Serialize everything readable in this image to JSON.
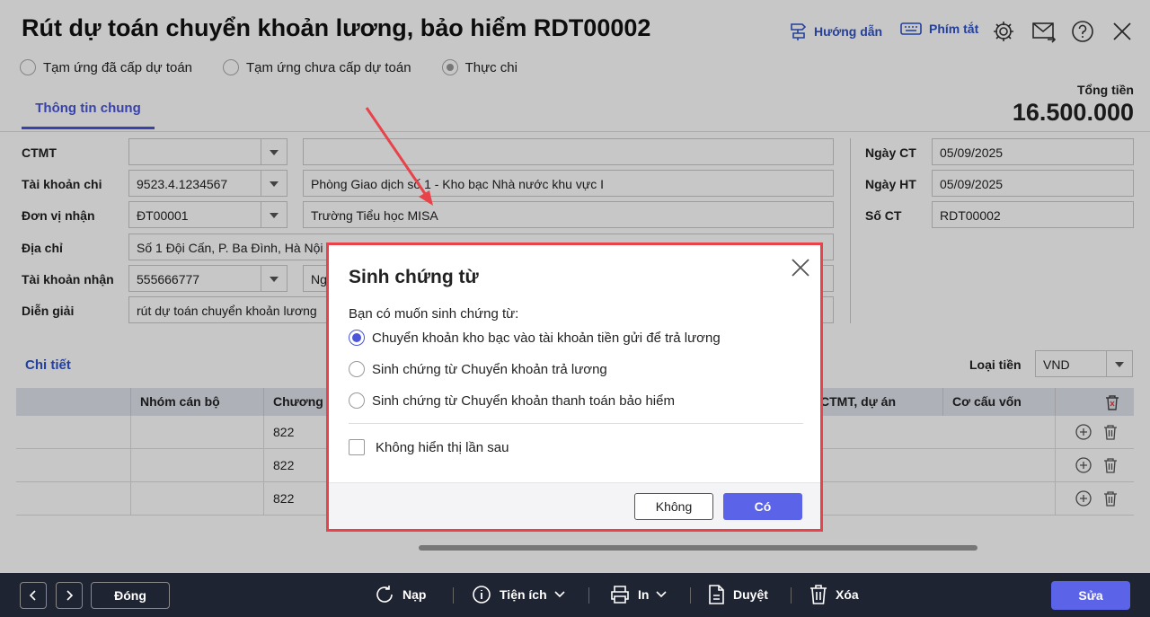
{
  "header": {
    "title": "Rút dự toán chuyển khoản lương, bảo hiểm RDT00002",
    "guide_label": "Hướng dẫn",
    "shortcut_label": "Phím tắt"
  },
  "radios": {
    "r1": "Tạm ứng đã cấp dự toán",
    "r2": "Tạm ứng chưa cấp dự toán",
    "r3": "Thực chi"
  },
  "tab": "Thông tin chung",
  "total": {
    "label": "Tổng tiền",
    "value": "16.500.000"
  },
  "form": {
    "ctmt_label": "CTMT",
    "taikhoanchi_label": "Tài khoản chi",
    "taikhoanchi_value": "9523.4.1234567",
    "taikhoanchi_name": "Phòng Giao dịch số 1 - Kho bạc Nhà nước khu vực I",
    "donvinhan_label": "Đơn vị nhận",
    "donvinhan_value": "ĐT00001",
    "donvinhan_name": "Trường Tiểu học MISA",
    "diachi_label": "Địa chỉ",
    "diachi_value": "Số 1 Đội Cấn, P. Ba Đình, Hà Nội",
    "taikhoannhan_label": "Tài khoản nhận",
    "taikhoannhan_value": "555666777",
    "taikhoannhan_name": "Ng",
    "diengiai_label": "Diễn giải",
    "diengiai_value": "rút dự toán chuyển khoản lương",
    "ngayct_label": "Ngày CT",
    "ngayct_value": "05/09/2025",
    "ngayht_label": "Ngày HT",
    "ngayht_value": "05/09/2025",
    "soct_label": "Số CT",
    "soct_value": "RDT00002"
  },
  "detail": {
    "title": "Chi tiết",
    "currency_label": "Loại tiền",
    "currency_value": "VND",
    "columns": {
      "c2": "Nhóm cán bộ",
      "c3": "Chương",
      "c4": "CTMT, dự án",
      "c5": "Cơ cấu vốn"
    },
    "rows": [
      "822",
      "822",
      "822"
    ]
  },
  "footer": {
    "close": "Đóng",
    "reload": "Nạp",
    "utility": "Tiện ích",
    "print": "In",
    "approve": "Duyệt",
    "delete": "Xóa",
    "edit": "Sửa"
  },
  "dialog": {
    "title": "Sinh chứng từ",
    "question": "Bạn có muốn sinh chứng từ:",
    "options": [
      "Chuyển khoản kho bạc vào tài khoản tiền gửi để trả lương",
      "Sinh chứng từ Chuyển khoản trả lương",
      "Sinh chứng từ Chuyển khoản thanh toán bảo hiểm"
    ],
    "dont_show": "Không hiển thị lần sau",
    "no": "Không",
    "yes": "Có"
  },
  "colors": {
    "accent": "#5b63e8",
    "link": "#2f53c8",
    "highlight": "#e8434a"
  }
}
